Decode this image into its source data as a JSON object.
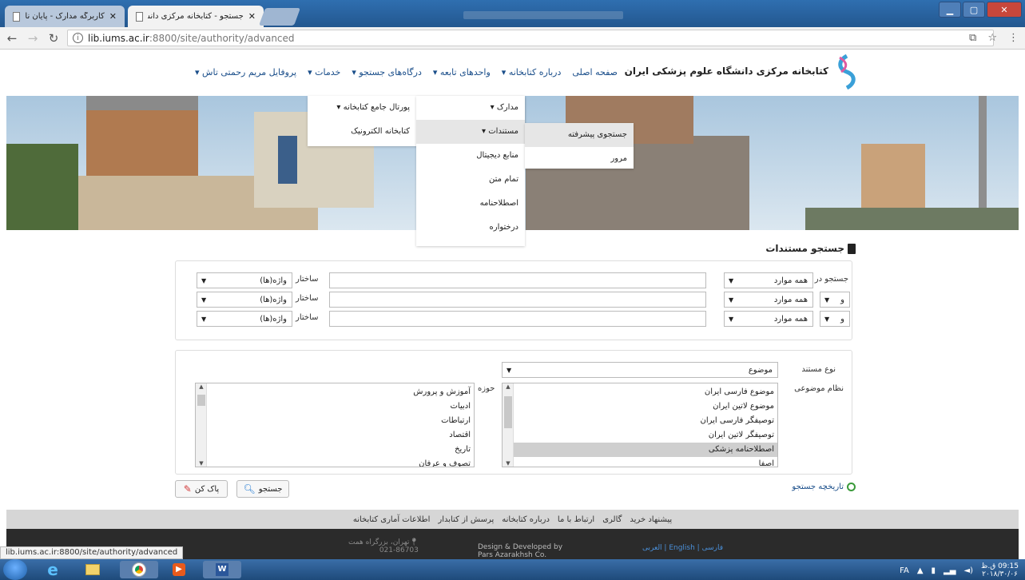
{
  "browser": {
    "tabs": [
      {
        "title": "کاربرگه مدارک - پایان نامه فارسی",
        "active": false
      },
      {
        "title": "جستجو - کتابخانه مرکزی دانشگاه",
        "active": true
      }
    ],
    "url_host": "lib.iums.ac.ir",
    "url_path": ":8800/site/authority/advanced",
    "status_url": "lib.iums.ac.ir:8800/site/authority/advanced"
  },
  "site": {
    "logo_text": "کتابخانه مرکزی دانشگاه علوم پزشکی ایران",
    "nav": [
      "صفحه اصلی",
      "درباره کتابخانه ▾",
      "واحدهای تابعه ▾",
      "درگاه‌های جستجو ▾",
      "خدمات ▾",
      "پروفایل مریم رحمتی تاش ▾"
    ]
  },
  "menu": {
    "col1": [
      "پورتال جامع کتابخانه ▾",
      "کتابخانه الکترونیک"
    ],
    "col2": [
      "مدارک ▾",
      "مستندات ▾",
      "منابع دیجیتال",
      "تمام متن",
      "اصطلاحنامه",
      "درختواره"
    ],
    "col3": [
      "جستجوی پیشرفته",
      "مرور"
    ]
  },
  "page_title": "جستجو مستندات",
  "search": {
    "search_in_label": "جستجو در",
    "structure_label": "ساختار",
    "rows": [
      {
        "connector": "",
        "field": "همه موارد",
        "structure": "واژه(ها)"
      },
      {
        "connector": "و",
        "field": "همه موارد",
        "structure": "واژه(ها)"
      },
      {
        "connector": "و",
        "field": "همه موارد",
        "structure": "واژه(ها)"
      }
    ]
  },
  "filters": {
    "doc_type_label": "نوع مستند",
    "doc_type_value": "موضوع",
    "subject_system_label": "نظام موضوعی",
    "subject_system_options": [
      "موضوع فارسی ایران",
      "موضوع لاتین ایران",
      "توصیفگر فارسی ایران",
      "توصیفگر لاتین ایران",
      "اصطلاحنامه پزشکی",
      "اصفا"
    ],
    "subject_system_selected": 4,
    "field_label": "حوزه",
    "field_options": [
      "آموزش و پرورش",
      "ادبیات",
      "ارتباطات",
      "اقتصاد",
      "تاریخ",
      "تصوف و عرفان"
    ]
  },
  "buttons": {
    "search": "جستجو",
    "clear": "پاک کن"
  },
  "history_link": "تاریخچه جستجو",
  "footer": {
    "links": [
      "پیشنهاد خرید",
      "گالری",
      "ارتباط با ما",
      "درباره کتابخانه",
      "پرسش از کتابدار",
      "اطلاعات آماری کتابخانه"
    ],
    "lang": "فارسی | English | العربی",
    "design": "Design & Developed by",
    "design2": "Pars Azarakhsh Co.",
    "address": "تهران، بزرگراه همت",
    "phone": "021-86703"
  },
  "taskbar": {
    "lang": "FA",
    "time": "09:15 ق.ظ",
    "date": "۲۰۱۸/۳۰/۰۶"
  },
  "colors": {
    "link": "#1a4e8a",
    "accent": "#2f6fb0"
  }
}
